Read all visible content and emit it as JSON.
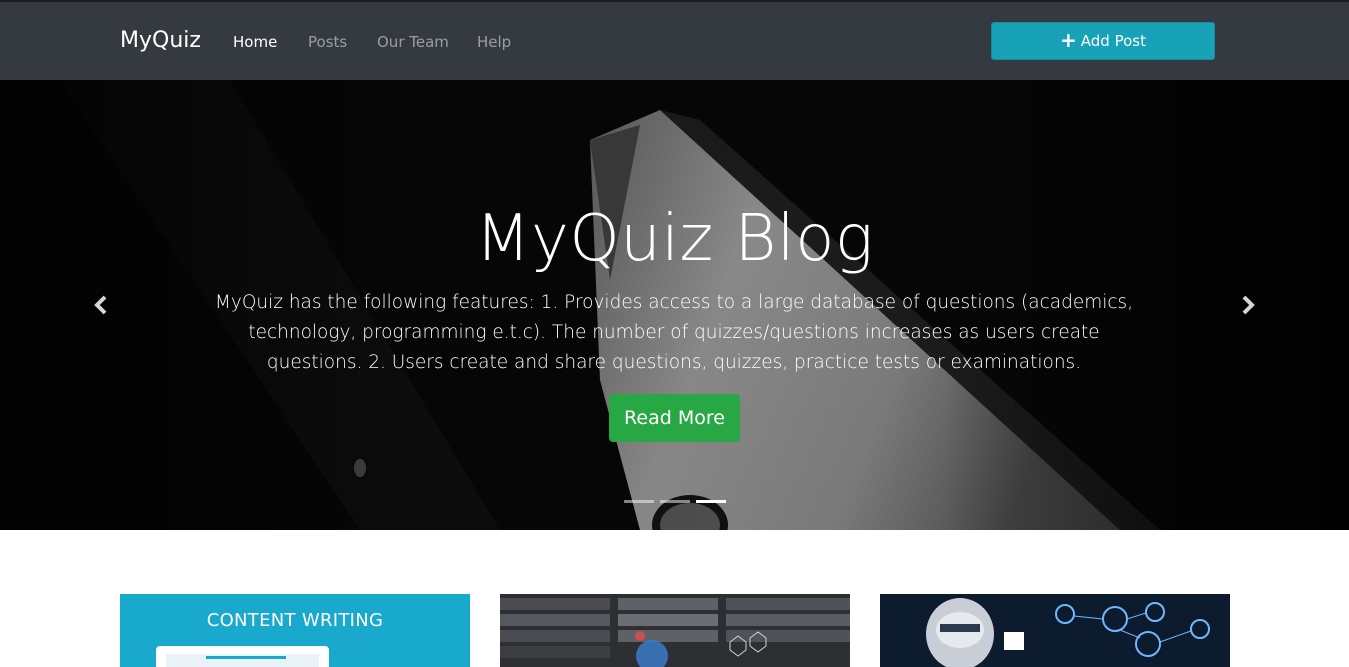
{
  "navbar": {
    "brand": "MyQuiz",
    "links": [
      {
        "label": "Home",
        "active": true
      },
      {
        "label": "Posts",
        "active": false
      },
      {
        "label": "Our Team",
        "active": false
      },
      {
        "label": "Help",
        "active": false
      }
    ],
    "add_post_label": "Add Post",
    "add_post_icon": "plus-icon"
  },
  "hero": {
    "title": "MyQuiz Blog",
    "description": "MyQuiz has the following features: 1. Provides access to a large database of questions (academics, technology, programming e.t.c). The number of quizzes/questions increases as users create questions. 2. Users create and share questions, quizzes, practice tests or examinations.",
    "read_more_label": "Read More",
    "prev_icon": "chevron-left-icon",
    "next_icon": "chevron-right-icon",
    "slide_count": 3,
    "active_slide": 3
  },
  "cards": [
    {
      "title": "CONTENT WRITING",
      "image": "laptop-illustration"
    },
    {
      "title": "",
      "image": "server-racks-photo"
    },
    {
      "title": "",
      "image": "robot-network-photo"
    }
  ],
  "colors": {
    "navbar_bg": "#343a40",
    "primary_button": "#17a2b8",
    "success_button": "#28a745",
    "card_teal": "#19a9cc"
  }
}
